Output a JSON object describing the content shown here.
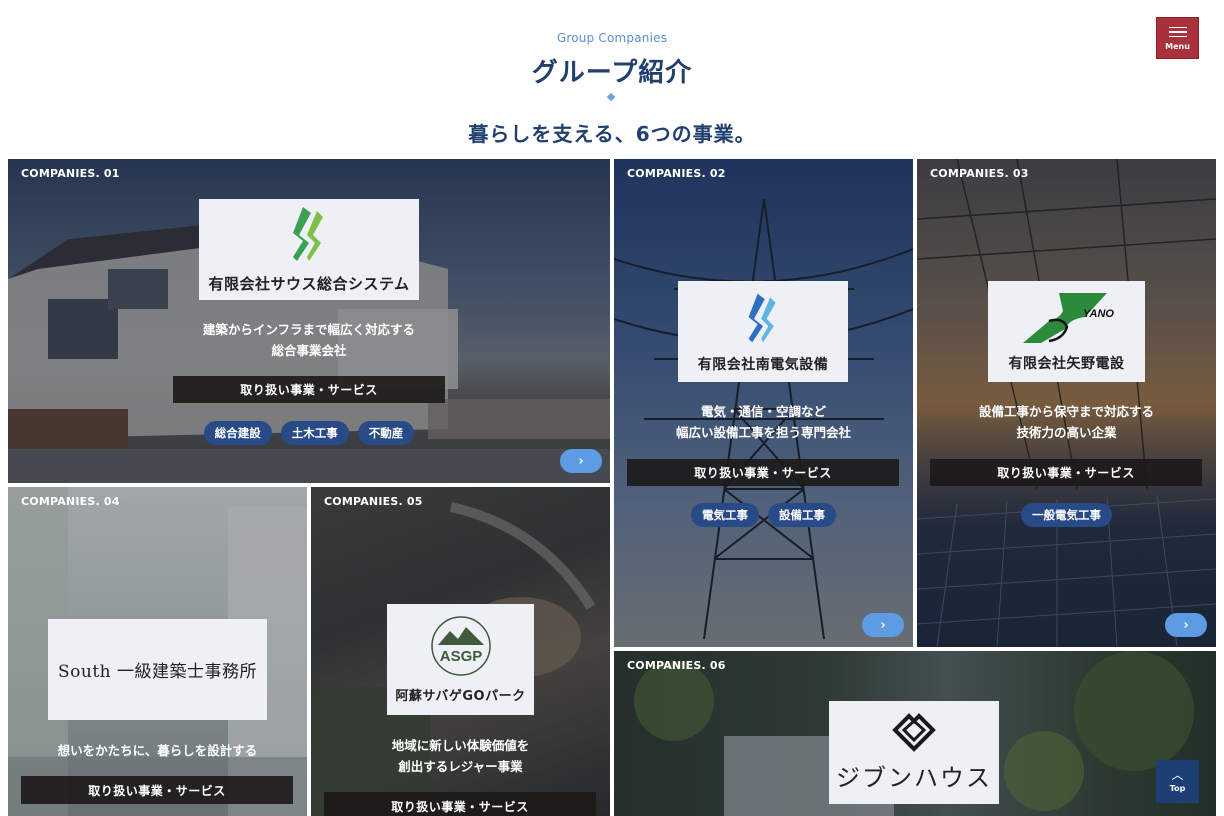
{
  "header": {
    "eyebrow": "Group Companies",
    "title": "グループ紹介",
    "subtitle": "暮らしを支える、6つの事業。"
  },
  "menu": {
    "label": "Menu"
  },
  "top": {
    "label": "Top",
    "icon": "chevron-up-icon"
  },
  "companies": [
    {
      "number": "COMPANIES. 01",
      "name": "有限会社サウス総合システム",
      "logo_icon": "south-green-leaf-logo",
      "desc": [
        "建築からインフラまで幅広く対応する",
        "総合事業会社"
      ],
      "services_label": "取り扱い事業・サービス",
      "tags": [
        "総合建設",
        "土木工事",
        "不動産"
      ]
    },
    {
      "number": "COMPANIES. 02",
      "name": "有限会社南電気設備",
      "logo_icon": "south-blue-leaf-logo",
      "desc": [
        "電気・通信・空調など",
        "幅広い設備工事を担う専門会社"
      ],
      "services_label": "取り扱い事業・サービス",
      "tags": [
        "電気工事",
        "設備工事"
      ]
    },
    {
      "number": "COMPANIES. 03",
      "name": "有限会社矢野電設",
      "logo_icon": "yano-logo",
      "logo_text": "YANO",
      "desc": [
        "設備工事から保守まで対応する",
        "技術力の高い企業"
      ],
      "services_label": "取り扱い事業・サービス",
      "tags": [
        "一般電気工事"
      ]
    },
    {
      "number": "COMPANIES. 04",
      "name": "South 一級建築士事務所",
      "desc": [
        "想いをかたちに、暮らしを設計する"
      ],
      "services_label": "取り扱い事業・サービス"
    },
    {
      "number": "COMPANIES. 05",
      "name": "阿蘇サバゲGOパーク",
      "logo_icon": "asgp-mountain-logo",
      "logo_text": "ASGP",
      "desc": [
        "地域に新しい体験価値を",
        "創出するレジャー事業"
      ],
      "services_label": "取り扱い事業・サービス"
    },
    {
      "number": "COMPANIES. 06",
      "name": "ジブンハウス",
      "logo_icon": "jibun-house-diamond-logo"
    }
  ],
  "colors": {
    "accent_red": "#a9323a",
    "navy": "#22406e",
    "tag_blue": "#284a86",
    "arrow_blue": "#5d9be3"
  }
}
